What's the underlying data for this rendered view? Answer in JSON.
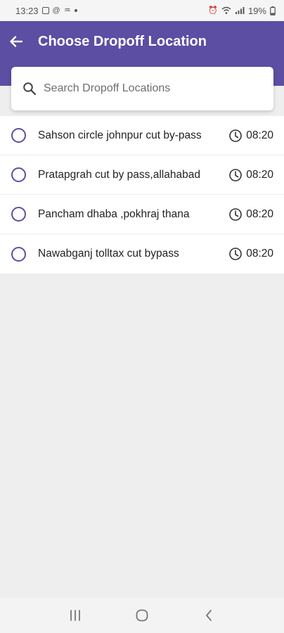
{
  "status_bar": {
    "time": "13:23",
    "battery": "19%"
  },
  "header": {
    "title": "Choose Dropoff Location",
    "back_icon": "arrow-left-icon"
  },
  "search": {
    "placeholder": "Search Dropoff Locations",
    "value": "",
    "icon": "search-icon"
  },
  "locations": [
    {
      "name": "Sahson circle johnpur cut by-pass",
      "time": "08:20"
    },
    {
      "name": "Pratapgrah cut by pass,allahabad",
      "time": "08:20"
    },
    {
      "name": "Pancham dhaba ,pokhraj thana",
      "time": "08:20"
    },
    {
      "name": "Nawabganj tolltax cut bypass",
      "time": "08:20"
    }
  ],
  "nav_bar": {
    "recent_icon": "recent-apps-icon",
    "home_icon": "home-icon",
    "back_icon": "back-icon"
  },
  "colors": {
    "primary": "#5b4ea3",
    "background": "#eeeeee",
    "surface": "#ffffff"
  }
}
